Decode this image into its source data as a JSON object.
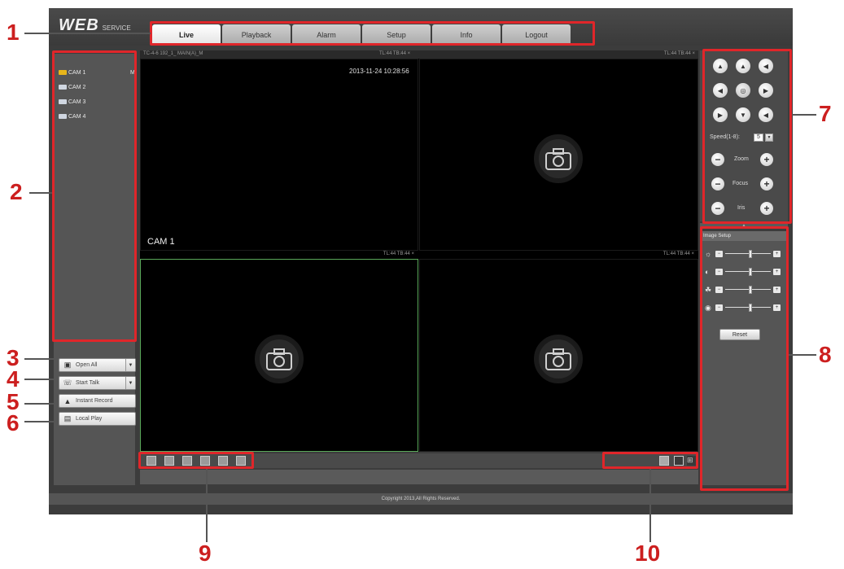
{
  "header": {
    "logo_main": "WEB",
    "logo_sub": "SERVICE",
    "tabs": [
      "Live",
      "Playback",
      "Alarm",
      "Setup",
      "Info",
      "Logout"
    ],
    "active_tab": "Live"
  },
  "camera_list": [
    {
      "label": "CAM 1",
      "active": true,
      "mode": "M"
    },
    {
      "label": "CAM 2",
      "active": false
    },
    {
      "label": "CAM 3",
      "active": false
    },
    {
      "label": "CAM 4",
      "active": false
    }
  ],
  "left_buttons": {
    "open_all": "Open All",
    "start_talk": "Start Talk",
    "instant_record": "Instant Record",
    "local_play": "Local Play"
  },
  "video": {
    "header_info": "TC-4-6 192_1_ MAIN(A)_M",
    "pane_status": "TL:44 TB:44 ×",
    "timestamp": "2013-11-24 10:28:56",
    "pane1_label": "CAM 1"
  },
  "ptz": {
    "speed_label": "Speed(1-8):",
    "speed_value": "5",
    "zoom_label": "Zoom",
    "focus_label": "Focus",
    "iris_label": "Iris"
  },
  "image_setup": {
    "title": "Image Setup",
    "sliders": [
      {
        "name": "brightness",
        "level": 0.55
      },
      {
        "name": "contrast",
        "level": 0.55
      },
      {
        "name": "saturation",
        "level": 0.55
      },
      {
        "name": "hue",
        "level": 0.55
      }
    ],
    "reset_label": "Reset"
  },
  "footer": {
    "copyright": "Copyright 2013,All Rights Reserved."
  },
  "callouts": [
    "1",
    "2",
    "3",
    "4",
    "5",
    "6",
    "7",
    "8",
    "9",
    "10"
  ],
  "colors": {
    "callout": "#cc1f1f",
    "highlight_box": "#e0262a",
    "active_cam": "#e7b51a",
    "selected_pane": "#5aa85a"
  }
}
